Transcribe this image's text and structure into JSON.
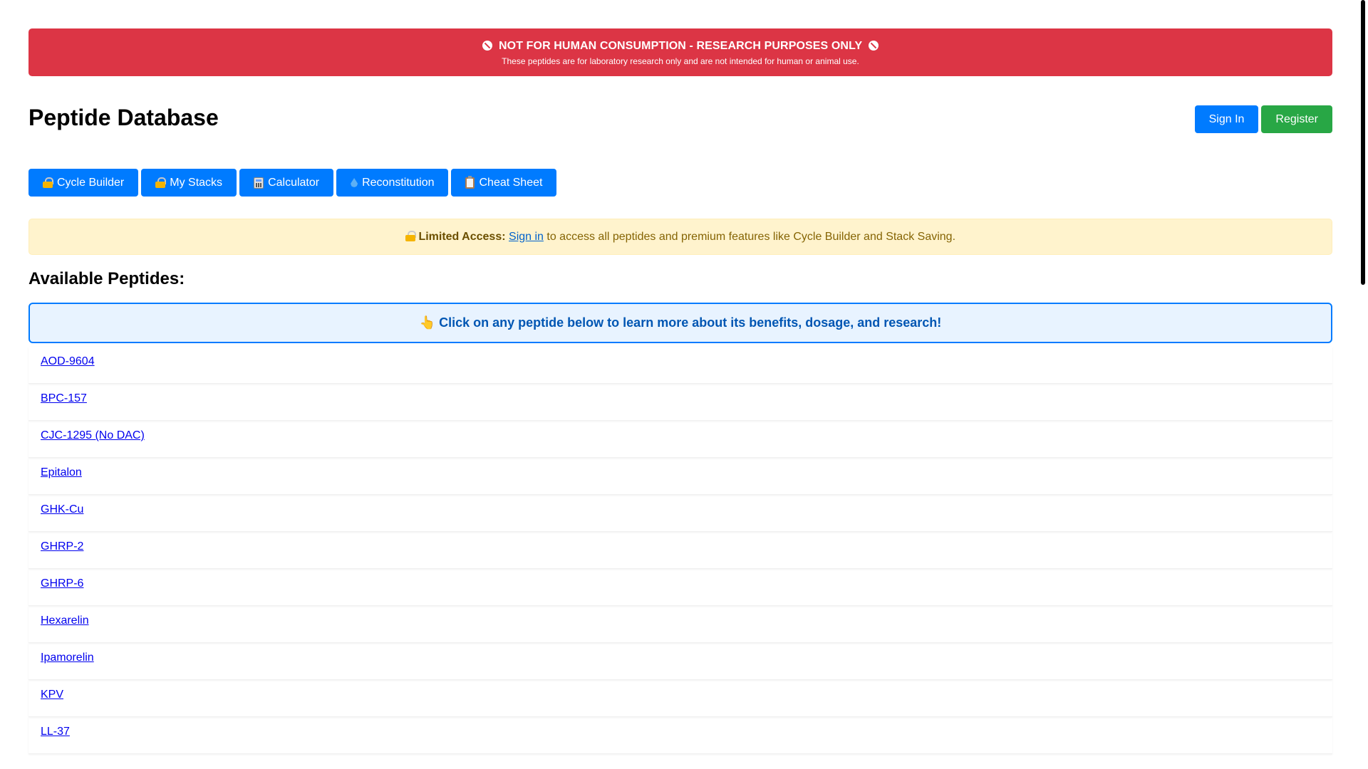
{
  "warning": {
    "title": "NOT FOR HUMAN CONSUMPTION - RESEARCH PURPOSES ONLY",
    "subtitle": "These peptides are for laboratory research only and are not intended for human or animal use.",
    "icon": "no-entry-icon"
  },
  "header": {
    "title": "Peptide Database",
    "sign_in_label": "Sign In",
    "register_label": "Register"
  },
  "nav": [
    {
      "icon": "lock-icon",
      "label": "Cycle Builder"
    },
    {
      "icon": "lock-icon",
      "label": "My Stacks"
    },
    {
      "icon": "calculator-icon",
      "label": "Calculator"
    },
    {
      "icon": "droplet-icon",
      "label": "Reconstitution"
    },
    {
      "icon": "clipboard-icon",
      "label": "Cheat Sheet"
    }
  ],
  "notice": {
    "icon": "lock-icon",
    "strong": "Limited Access:",
    "link": "Sign in",
    "text": "to access all peptides and premium features like Cycle Builder and Stack Saving."
  },
  "section_title": "Available Peptides:",
  "hint": {
    "icon": "pointing-hand-icon",
    "text": "Click on any peptide below to learn more about its benefits, dosage, and research!"
  },
  "peptides": [
    "AOD-9604",
    "BPC-157",
    "CJC-1295 (No DAC)",
    "Epitalon",
    "GHK-Cu",
    "GHRP-2",
    "GHRP-6",
    "Hexarelin",
    "Ipamorelin",
    "KPV",
    "LL-37"
  ],
  "colors": {
    "danger": "#dc3545",
    "primary": "#007bff",
    "success": "#28a745",
    "warning_bg": "#fff3cd",
    "info_bg": "#e8f3ff"
  }
}
